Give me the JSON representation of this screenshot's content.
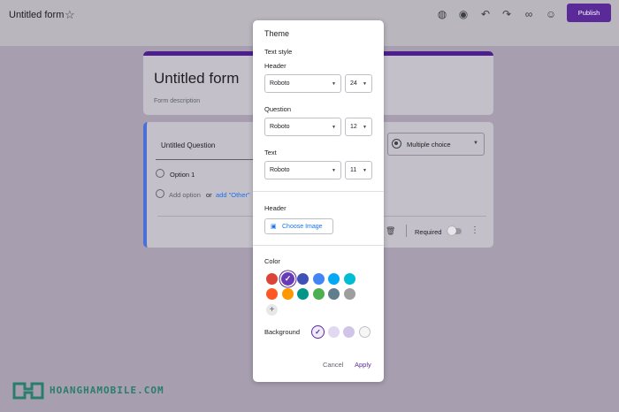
{
  "topbar": {
    "form_title": "Untitled form",
    "icons": [
      "star-icon",
      "palette-icon",
      "preview-icon",
      "undo-icon",
      "redo-icon",
      "link-icon",
      "add-collaborator-icon"
    ],
    "publish_label": "Publish",
    "publish_color": "#5a2a99"
  },
  "header_card": {
    "title": "Untitled form",
    "description": "Form description",
    "accent_color": "#4d1f8e"
  },
  "question_card": {
    "question": "Untitled Question",
    "option_1": "Option 1",
    "add_option": "Add option",
    "or": "or",
    "add_other": "add \"Other\"",
    "type_select": "Multiple choice",
    "required_label": "Required"
  },
  "theme_panel": {
    "title": "Theme",
    "text_style": "Text style",
    "header_label": "Header",
    "header_font": "Roboto",
    "header_size": "24",
    "question_label": "Question",
    "question_font": "Roboto",
    "question_size": "12",
    "text_label": "Text",
    "text_font": "Roboto",
    "text_size": "11",
    "header_image_label": "Header",
    "choose_image": "Choose Image",
    "color_label": "Color",
    "colors": [
      "#db4437",
      "#673ab7",
      "#3f51b5",
      "#4285f4",
      "#03a9f4",
      "#00bcd4",
      "#ff5722",
      "#ff9800",
      "#009688",
      "#4caf50",
      "#607d8b",
      "#9e9e9e"
    ],
    "selected_color": "#673ab7",
    "background_label": "Background",
    "backgrounds": [
      "#f0ebf8",
      "#e1d8f1",
      "#d1c4e9",
      "#f6f6f6"
    ],
    "cancel": "Cancel",
    "apply": "Apply"
  },
  "watermark": {
    "text": "HOANGHAMOBILE.COM"
  }
}
